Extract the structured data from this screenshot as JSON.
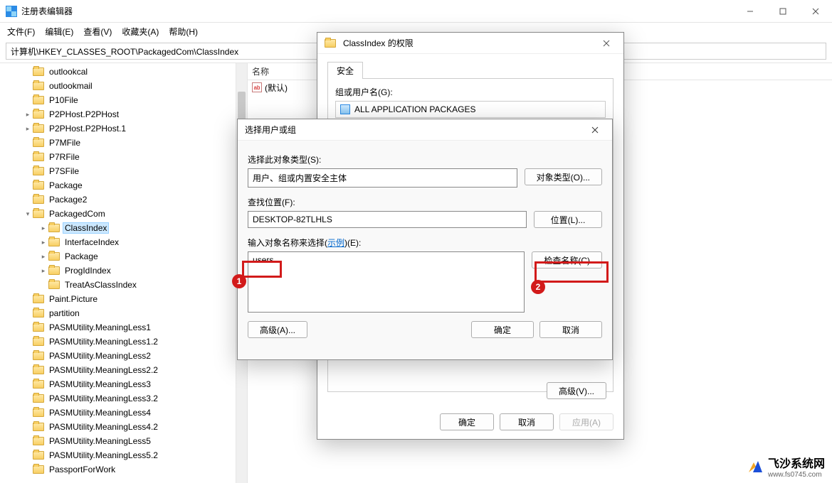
{
  "window": {
    "title": "注册表编辑器"
  },
  "menu": {
    "file": "文件(F)",
    "edit": "编辑(E)",
    "view": "查看(V)",
    "fav": "收藏夹(A)",
    "help": "帮助(H)"
  },
  "address": "计算机\\HKEY_CLASSES_ROOT\\PackagedCom\\ClassIndex",
  "tree": {
    "items": [
      {
        "label": "outlookcal",
        "lvl": 1,
        "t": ""
      },
      {
        "label": "outlookmail",
        "lvl": 1,
        "t": ""
      },
      {
        "label": "P10File",
        "lvl": 1,
        "t": ""
      },
      {
        "label": "P2PHost.P2PHost",
        "lvl": 1,
        "t": ">"
      },
      {
        "label": "P2PHost.P2PHost.1",
        "lvl": 1,
        "t": ">"
      },
      {
        "label": "P7MFile",
        "lvl": 1,
        "t": ""
      },
      {
        "label": "P7RFile",
        "lvl": 1,
        "t": ""
      },
      {
        "label": "P7SFile",
        "lvl": 1,
        "t": ""
      },
      {
        "label": "Package",
        "lvl": 1,
        "t": ""
      },
      {
        "label": "Package2",
        "lvl": 1,
        "t": ""
      },
      {
        "label": "PackagedCom",
        "lvl": 1,
        "t": "v"
      },
      {
        "label": "ClassIndex",
        "lvl": 2,
        "t": ">",
        "sel": true
      },
      {
        "label": "InterfaceIndex",
        "lvl": 2,
        "t": ">"
      },
      {
        "label": "Package",
        "lvl": 2,
        "t": ">"
      },
      {
        "label": "ProgIdIndex",
        "lvl": 2,
        "t": ">"
      },
      {
        "label": "TreatAsClassIndex",
        "lvl": 2,
        "t": ""
      },
      {
        "label": "Paint.Picture",
        "lvl": 1,
        "t": ""
      },
      {
        "label": "partition",
        "lvl": 1,
        "t": ""
      },
      {
        "label": "PASMUtility.MeaningLess1",
        "lvl": 1,
        "t": ""
      },
      {
        "label": "PASMUtility.MeaningLess1.2",
        "lvl": 1,
        "t": ""
      },
      {
        "label": "PASMUtility.MeaningLess2",
        "lvl": 1,
        "t": ""
      },
      {
        "label": "PASMUtility.MeaningLess2.2",
        "lvl": 1,
        "t": ""
      },
      {
        "label": "PASMUtility.MeaningLess3",
        "lvl": 1,
        "t": ""
      },
      {
        "label": "PASMUtility.MeaningLess3.2",
        "lvl": 1,
        "t": ""
      },
      {
        "label": "PASMUtility.MeaningLess4",
        "lvl": 1,
        "t": ""
      },
      {
        "label": "PASMUtility.MeaningLess4.2",
        "lvl": 1,
        "t": ""
      },
      {
        "label": "PASMUtility.MeaningLess5",
        "lvl": 1,
        "t": ""
      },
      {
        "label": "PASMUtility.MeaningLess5.2",
        "lvl": 1,
        "t": ""
      },
      {
        "label": "PassportForWork",
        "lvl": 1,
        "t": ""
      }
    ]
  },
  "list": {
    "col_name": "名称",
    "default_value": "(默认)"
  },
  "perm_dialog": {
    "title": "ClassIndex 的权限",
    "tab_security": "安全",
    "group_label": "组或用户名(G):",
    "group_item": "ALL APPLICATION PACKAGES",
    "advanced_stub": "高级(V)...",
    "ok": "确定",
    "cancel": "取消",
    "apply": "应用(A)"
  },
  "select_dialog": {
    "title": "选择用户或组",
    "obj_type_label": "选择此对象类型(S):",
    "obj_type_value": "用户、组或内置安全主体",
    "obj_type_btn": "对象类型(O)...",
    "location_label": "查找位置(F):",
    "location_value": "DESKTOP-82TLHLS",
    "location_btn": "位置(L)...",
    "names_label_a": "输入对象名称来选择(",
    "names_label_link": "示例",
    "names_label_b": ")(E):",
    "names_value": "users",
    "check_btn": "检查名称(C)",
    "advanced_btn": "高级(A)...",
    "ok": "确定",
    "cancel": "取消"
  },
  "callouts": {
    "n1": "1",
    "n2": "2"
  },
  "watermark": {
    "name": "飞沙系统网",
    "url": "www.fs0745.com"
  }
}
